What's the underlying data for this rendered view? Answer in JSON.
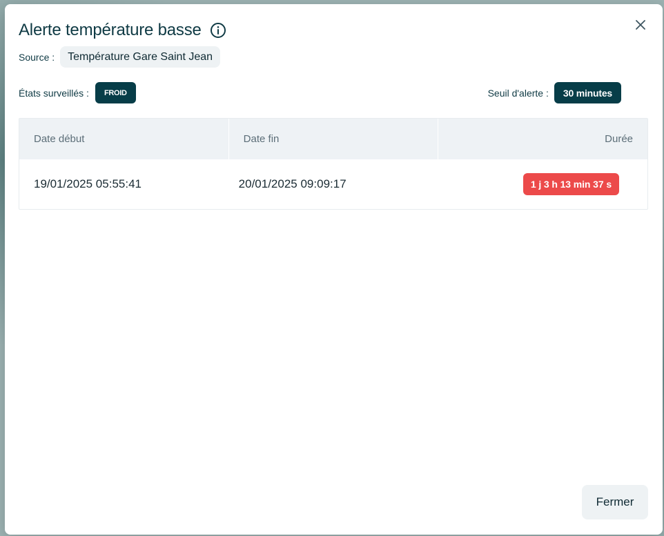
{
  "dialog": {
    "title": "Alerte température basse",
    "info_icon": "info-circle-icon",
    "close_icon": "close-x-icon",
    "source_label": "Source :",
    "source_value": "Température Gare Saint Jean",
    "states_label": "États surveillés :",
    "states": [
      "FROID"
    ],
    "threshold_label": "Seuil d'alerte :",
    "threshold_value": "30 minutes",
    "close_button_label": "Fermer"
  },
  "table": {
    "columns": [
      "Date début",
      "Date fin",
      "Durée"
    ],
    "rows": [
      {
        "start": "19/01/2025 05:55:41",
        "end": "20/01/2025 09:09:17",
        "duration": "1 j 3 h 13 min 37 s"
      }
    ]
  },
  "colors": {
    "title": "#0f3a44",
    "chip_dark": "#073d48",
    "chip_light": "#eef2f4",
    "duration_badge": "#ec4a4a",
    "table_header_bg": "#eef2f5"
  }
}
